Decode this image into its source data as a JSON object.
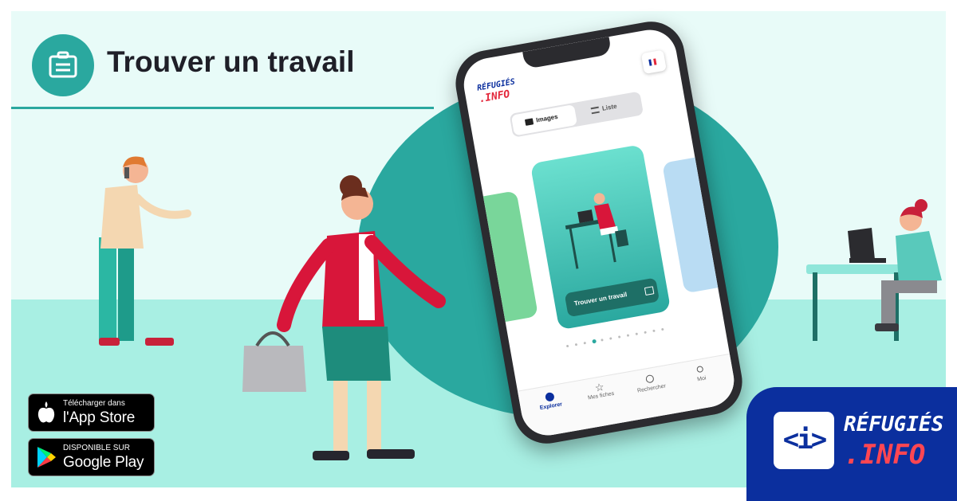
{
  "header": {
    "title": "Trouver un travail",
    "icon": "briefcase-icon"
  },
  "stores": {
    "apple": {
      "small": "Télécharger dans",
      "big": "l'App Store",
      "icon": "apple-icon"
    },
    "google": {
      "small": "DISPONIBLE SUR",
      "big": "Google Play",
      "icon": "google-play-icon"
    }
  },
  "brand": {
    "line1": "RÉFUGIÉS",
    "line2": ".INFO",
    "mark": "<i>"
  },
  "phone": {
    "logo_line1": "RÉFUGIÉS",
    "logo_line2": ".INFO",
    "flag": "french-flag-icon",
    "toggle": {
      "images": "Images",
      "liste": "Liste"
    },
    "card_button": "Trouver un travail",
    "carousel": {
      "count": 12,
      "active": 3
    },
    "nav": [
      {
        "label": "Explorer",
        "icon": "compass-icon",
        "active": true
      },
      {
        "label": "Mes fiches",
        "icon": "star-icon",
        "active": false
      },
      {
        "label": "Rechercher",
        "icon": "search-icon",
        "active": false
      },
      {
        "label": "Moi",
        "icon": "user-icon",
        "active": false
      }
    ]
  },
  "colors": {
    "teal": "#2aa89f",
    "light_bg": "#e8fbf8",
    "floor": "#a8efe3",
    "brand_blue": "#0b2f9e",
    "brand_red": "#e3263a"
  }
}
